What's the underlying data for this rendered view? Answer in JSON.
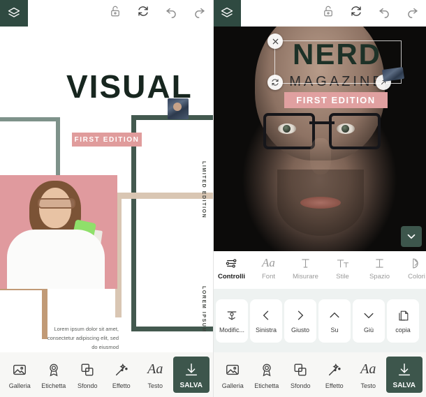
{
  "topbar": {
    "layers_icon": "layers-icon",
    "icons": [
      {
        "name": "unlock-icon",
        "label": "unlock"
      },
      {
        "name": "refresh-icon",
        "label": "refresh"
      },
      {
        "name": "undo-icon",
        "label": "undo"
      },
      {
        "name": "redo-icon",
        "label": "redo"
      }
    ]
  },
  "left_canvas": {
    "title": "VISUAL",
    "badge": "FIRST EDITION",
    "vertical_right_top": "LIMITED EDITION",
    "vertical_right_bottom": "LOREM IPSUM",
    "body_text": "Lorem ipsum dolor sit amet, consectetur adipiscing elit, sed do eiusmod",
    "thumbnail_name": "photo-thumbnail",
    "colors": {
      "title": "#17261f",
      "badge_bg": "#e09c9c",
      "frame_green_dark": "#43594f",
      "frame_green_light": "#7e928a",
      "frame_tan": "#d9c6b3",
      "frame_brown": "#c19a76",
      "photo_bg": "#e09a9e"
    }
  },
  "right_canvas": {
    "title": "NERD",
    "subtitle": "MAGAZINE",
    "badge": "FIRST EDITION",
    "selection": {
      "close_handle": "close-handle-icon",
      "rotate_handle": "rotate-handle-icon",
      "resize_handle": "resize-handle-icon"
    },
    "chevron_button": "chevron-down-button",
    "colors": {
      "title": "#1d3127",
      "badge_bg": "#e0a0a0",
      "chevron_bg": "#3d564c"
    }
  },
  "text_toolbar": {
    "items": [
      {
        "label": "Controlli",
        "icon": "sliders-icon",
        "active": true
      },
      {
        "label": "Font",
        "icon": "font-aa-icon",
        "active": false
      },
      {
        "label": "Misurare",
        "icon": "measure-icon",
        "active": false
      },
      {
        "label": "Stile",
        "icon": "text-style-icon",
        "active": false
      },
      {
        "label": "Spazio",
        "icon": "spacing-icon",
        "active": false
      },
      {
        "label": "Colori",
        "icon": "color-palette-icon",
        "active": false
      }
    ]
  },
  "align_toolbar": {
    "items": [
      {
        "label": "Modific...",
        "icon": "edit-anchor-icon",
        "boxed": true
      },
      {
        "label": "Sinistra",
        "icon": "chevron-left-icon",
        "boxed": true
      },
      {
        "label": "Giusto",
        "icon": "chevron-right-icon",
        "boxed": true
      },
      {
        "label": "Su",
        "icon": "chevron-up-icon",
        "boxed": true
      },
      {
        "label": "Giù",
        "icon": "chevron-down-icon",
        "boxed": true
      },
      {
        "label": "copia",
        "icon": "copy-icon",
        "boxed": true
      }
    ]
  },
  "bottom_bar": {
    "items": [
      {
        "label": "Galleria",
        "icon": "gallery-icon"
      },
      {
        "label": "Etichetta",
        "icon": "badge-ribbon-icon"
      },
      {
        "label": "Sfondo",
        "icon": "layers-square-icon"
      },
      {
        "label": "Effetto",
        "icon": "magic-wand-icon"
      },
      {
        "label": "Testo",
        "icon": "text-aa-icon"
      }
    ],
    "save_label": "SALVA",
    "save_icon": "download-icon",
    "save_color": "#3d564c"
  }
}
